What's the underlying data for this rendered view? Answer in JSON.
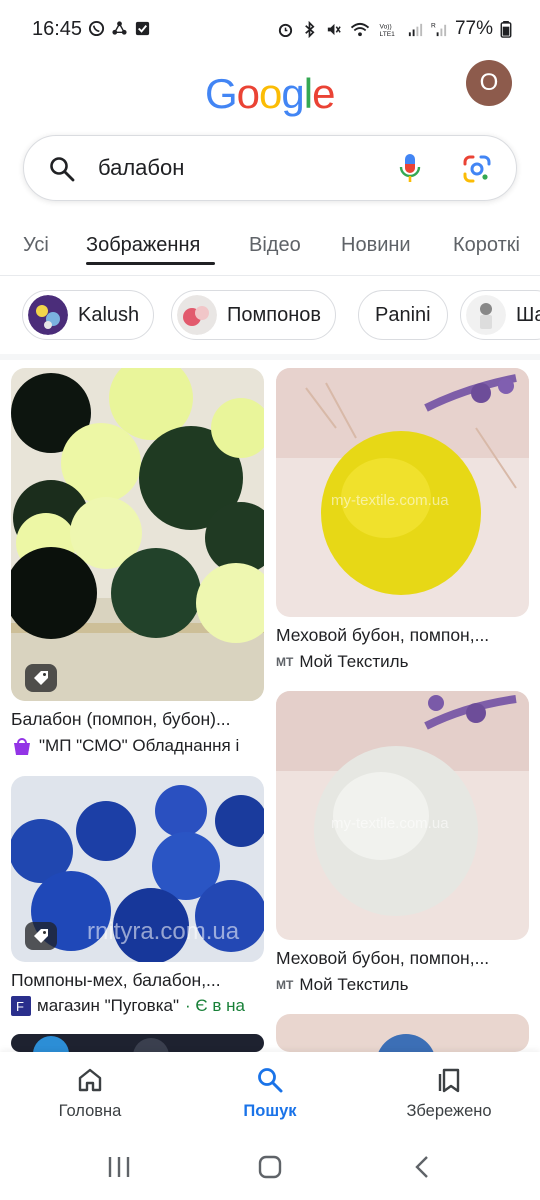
{
  "status_bar": {
    "time": "16:45",
    "battery": "77%"
  },
  "header": {
    "logo_letters": [
      "G",
      "o",
      "o",
      "g",
      "l",
      "e"
    ],
    "logo_colors": [
      "#4285F4",
      "#EA4335",
      "#FBBC05",
      "#4285F4",
      "#34A853",
      "#EA4335"
    ],
    "avatar_initial": "O"
  },
  "search": {
    "query": "балабон"
  },
  "tabs": [
    {
      "label": "Усі"
    },
    {
      "label": "Зображення",
      "active": true
    },
    {
      "label": "Відео"
    },
    {
      "label": "Новини"
    },
    {
      "label": "Короткі"
    }
  ],
  "chips": [
    {
      "label": "Kalush"
    },
    {
      "label": "Помпонов"
    },
    {
      "label": "Panini"
    },
    {
      "label": "Ша"
    }
  ],
  "results": [
    {
      "caption": "Балабон (помпон, бубон)...",
      "source": "\"МП \"СМО\" Обладнання і"
    },
    {
      "caption": "Помпоны-мех, балабон,...",
      "source": "магазин \"Пуговка\"",
      "extra": "· Є в на",
      "watermark": "rnityra.com.ua"
    },
    {
      "caption": "Меховой бубон, помпон,...",
      "source": "Мой Текстиль",
      "source_logo": "МТ",
      "watermark": "my-textile.com.ua"
    },
    {
      "caption": "Меховой бубон, помпон,...",
      "source": "Мой Текстиль",
      "source_logo": "МТ",
      "watermark": "my-textile.com.ua"
    }
  ],
  "bottom_nav": [
    {
      "label": "Головна"
    },
    {
      "label": "Пошук",
      "active": true
    },
    {
      "label": "Збережено"
    }
  ],
  "colors": {
    "accent": "#1a73e8",
    "text": "#202124",
    "secondary": "#5f6368"
  }
}
